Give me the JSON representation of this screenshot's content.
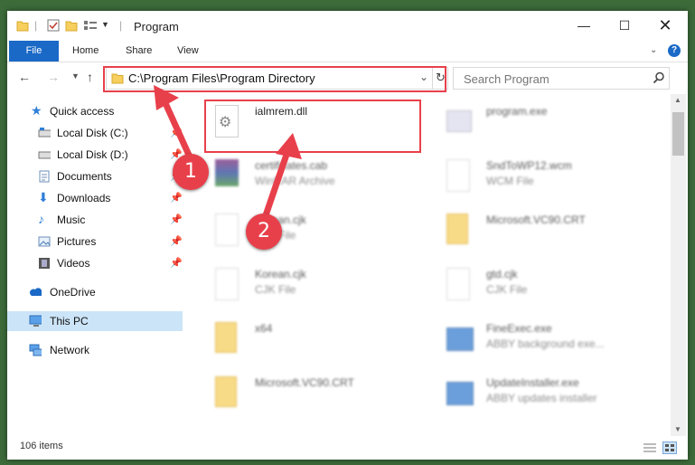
{
  "window": {
    "title": "Program"
  },
  "ribbon": {
    "tabs": [
      "File",
      "Home",
      "Share",
      "View"
    ]
  },
  "address": {
    "path": "C:\\Program Files\\Program Directory",
    "search_placeholder": "Search Program"
  },
  "nav": {
    "items": [
      {
        "label": "Quick access"
      },
      {
        "label": "Local Disk (C:)"
      },
      {
        "label": "Local Disk (D:)"
      },
      {
        "label": "Documents"
      },
      {
        "label": "Downloads"
      },
      {
        "label": "Music"
      },
      {
        "label": "Pictures"
      },
      {
        "label": "Videos"
      },
      {
        "label": "OneDrive"
      },
      {
        "label": "This PC"
      },
      {
        "label": "Network"
      }
    ]
  },
  "files": [
    {
      "name": "ialmrem.dll",
      "type": ""
    },
    {
      "name": "program.exe",
      "type": ""
    },
    {
      "name": "certificates.cab",
      "type": "WinRAR Archive"
    },
    {
      "name": "SndToWP12.wcm",
      "type": "WCM File"
    },
    {
      "name": "Korean.cjk",
      "type": "CJK File"
    },
    {
      "name": "Microsoft.VC90.CRT",
      "type": ""
    },
    {
      "name": "Korean.cjk",
      "type": "CJK File"
    },
    {
      "name": "gtd.cjk",
      "type": "CJK File"
    },
    {
      "name": "x64",
      "type": ""
    },
    {
      "name": "FineExec.exe",
      "type": "ABBY background exe..."
    },
    {
      "name": "Microsoft.VC90.CRT",
      "type": ""
    },
    {
      "name": "UpdateInstaller.exe",
      "type": "ABBY updates installer"
    }
  ],
  "status": {
    "items_count": "106 items"
  },
  "annotations": {
    "step1": "1",
    "step2": "2"
  },
  "colors": {
    "accent": "#1a69c7",
    "annotation_red": "#e8404b"
  }
}
